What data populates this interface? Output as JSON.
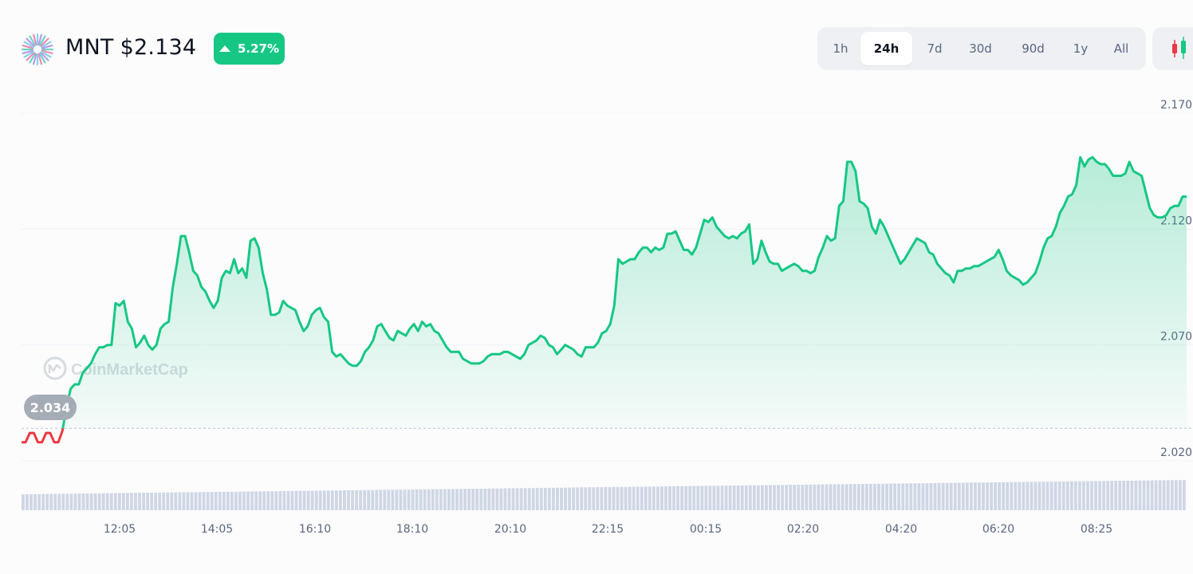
{
  "header": {
    "symbol": "MNT",
    "price": "$2.134",
    "change": "5.27%",
    "change_color": "#16c784"
  },
  "ranges": [
    "1h",
    "24h",
    "7d",
    "30d",
    "90d",
    "1y",
    "All"
  ],
  "active_range": "24h",
  "chart_type_icon": "candlestick-icon",
  "watermark": "CoinMarketCap",
  "colors": {
    "up": "#16c784",
    "down": "#ea3943",
    "grid": "#eff2f5",
    "axis_text": "#58667e",
    "volume": "#cfd6e4"
  },
  "chart_data": {
    "type": "area",
    "title": "",
    "xlabel": "",
    "ylabel": "",
    "ylim": [
      2.02,
      2.17
    ],
    "yticks": [
      "2.170",
      "2.120",
      "2.070",
      "2.020"
    ],
    "xticks": [
      "12:05",
      "14:05",
      "16:10",
      "18:10",
      "20:10",
      "22:15",
      "00:15",
      "02:20",
      "04:20",
      "06:20",
      "08:25"
    ],
    "baseline": 2.034,
    "baseline_label": "2.034",
    "grid": true,
    "series": [
      {
        "values": [
          2.028,
          2.028,
          2.032,
          2.032,
          2.028,
          2.028,
          2.032,
          2.032,
          2.028,
          2.028,
          2.033,
          2.043,
          2.051,
          2.053,
          2.053,
          2.058,
          2.06,
          2.062,
          2.066,
          2.069,
          2.069,
          2.07,
          2.07,
          2.088,
          2.087,
          2.089,
          2.08,
          2.077,
          2.069,
          2.071,
          2.074,
          2.07,
          2.068,
          2.07,
          2.077,
          2.079,
          2.08,
          2.095,
          2.105,
          2.117,
          2.117,
          2.11,
          2.102,
          2.1,
          2.095,
          2.093,
          2.089,
          2.086,
          2.089,
          2.099,
          2.102,
          2.101,
          2.107,
          2.101,
          2.103,
          2.099,
          2.115,
          2.116,
          2.112,
          2.101,
          2.094,
          2.083,
          2.083,
          2.084,
          2.089,
          2.087,
          2.086,
          2.085,
          2.08,
          2.076,
          2.078,
          2.083,
          2.085,
          2.086,
          2.082,
          2.08,
          2.067,
          2.065,
          2.066,
          2.064,
          2.062,
          2.061,
          2.061,
          2.063,
          2.067,
          2.069,
          2.072,
          2.078,
          2.079,
          2.076,
          2.073,
          2.072,
          2.076,
          2.075,
          2.074,
          2.077,
          2.079,
          2.076,
          2.08,
          2.078,
          2.079,
          2.076,
          2.075,
          2.072,
          2.069,
          2.067,
          2.067,
          2.067,
          2.064,
          2.063,
          2.062,
          2.062,
          2.062,
          2.063,
          2.065,
          2.066,
          2.066,
          2.066,
          2.067,
          2.067,
          2.066,
          2.065,
          2.064,
          2.066,
          2.07,
          2.071,
          2.072,
          2.074,
          2.073,
          2.07,
          2.069,
          2.066,
          2.068,
          2.07,
          2.069,
          2.068,
          2.066,
          2.065,
          2.069,
          2.069,
          2.069,
          2.071,
          2.075,
          2.076,
          2.079,
          2.087,
          2.107,
          2.105,
          2.106,
          2.107,
          2.107,
          2.11,
          2.112,
          2.112,
          2.11,
          2.112,
          2.111,
          2.112,
          2.118,
          2.118,
          2.119,
          2.115,
          2.111,
          2.111,
          2.109,
          2.112,
          2.118,
          2.124,
          2.123,
          2.125,
          2.121,
          2.119,
          2.117,
          2.116,
          2.117,
          2.116,
          2.118,
          2.119,
          2.122,
          2.105,
          2.107,
          2.115,
          2.11,
          2.106,
          2.105,
          2.105,
          2.102,
          2.103,
          2.104,
          2.105,
          2.104,
          2.102,
          2.102,
          2.101,
          2.102,
          2.108,
          2.112,
          2.117,
          2.115,
          2.116,
          2.13,
          2.132,
          2.149,
          2.149,
          2.145,
          2.132,
          2.131,
          2.129,
          2.121,
          2.118,
          2.124,
          2.121,
          2.117,
          2.113,
          2.109,
          2.105,
          2.107,
          2.11,
          2.113,
          2.116,
          2.115,
          2.114,
          2.11,
          2.109,
          2.105,
          2.103,
          2.101,
          2.1,
          2.097,
          2.102,
          2.102,
          2.103,
          2.103,
          2.104,
          2.104,
          2.105,
          2.106,
          2.107,
          2.108,
          2.111,
          2.107,
          2.102,
          2.1,
          2.099,
          2.098,
          2.096,
          2.097,
          2.099,
          2.101,
          2.106,
          2.112,
          2.116,
          2.117,
          2.121,
          2.127,
          2.13,
          2.134,
          2.135,
          2.139,
          2.151,
          2.147,
          2.15,
          2.151,
          2.149,
          2.148,
          2.148,
          2.146,
          2.143,
          2.143,
          2.143,
          2.144,
          2.149,
          2.145,
          2.144,
          2.143,
          2.136,
          2.129,
          2.126,
          2.125,
          2.125,
          2.126,
          2.129,
          2.13,
          2.13,
          2.134,
          2.134
        ]
      }
    ],
    "volume_note": "volume bars shown beneath chart"
  }
}
